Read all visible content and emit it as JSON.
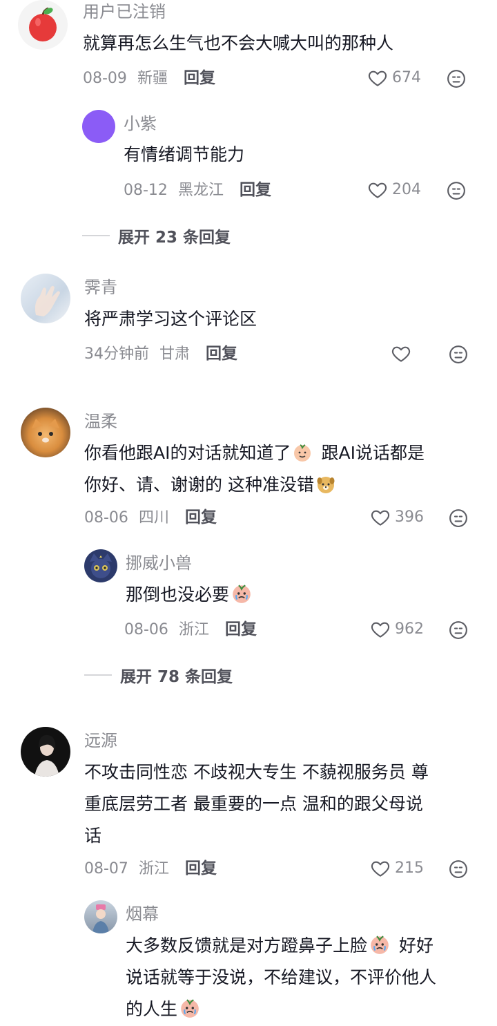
{
  "comments": [
    {
      "user": "用户已注销",
      "text": "就算再怎么生气也不会大喊大叫的那种人",
      "date": "08-09",
      "location": "新疆",
      "reply_label": "回复",
      "likes": "674",
      "avatar_icon": "apple-avatar-icon",
      "replies": [
        {
          "user": "小紫",
          "text": "有情绪调节能力",
          "date": "08-12",
          "location": "黑龙江",
          "reply_label": "回复",
          "likes": "204",
          "avatar_color": "#8b5cf6"
        }
      ],
      "expand_label": "展开 23 条回复"
    },
    {
      "user": "霁青",
      "text": "将严肃学习这个评论区",
      "date": "34分钟前",
      "location": "甘肃",
      "reply_label": "回复",
      "likes": ""
    },
    {
      "user": "温柔",
      "text_part1": "你看他跟AI的对话就知道了",
      "text_part2": "跟AI说话都是",
      "text_part3": "你好、请、谢谢的 这种准没错",
      "date": "08-06",
      "location": "四川",
      "reply_label": "回复",
      "likes": "396",
      "replies": [
        {
          "user": "挪威小兽",
          "text": "那倒也没必要",
          "date": "08-06",
          "location": "浙江",
          "reply_label": "回复",
          "likes": "962"
        }
      ],
      "expand_label": "展开 78 条回复"
    },
    {
      "user": "远源",
      "text_line1": "不攻击同性恋 不歧视大专生 不藐视服务员 尊",
      "text_line2": "重底层劳工者 最重要的一点 温和的跟父母说",
      "text_line3": "话",
      "date": "08-07",
      "location": "浙江",
      "reply_label": "回复",
      "likes": "215",
      "replies": [
        {
          "user": "烟幕",
          "text_line1": "大多数反馈就是对方蹬鼻子上脸",
          "text_line1b": "好好",
          "text_line2": "说话就等于没说，不给建议，不评价他人",
          "text_line3": "的人生"
        }
      ]
    }
  ],
  "colors": {
    "meta": "#8a8b91",
    "text": "#161823",
    "reply": "#50515a"
  }
}
